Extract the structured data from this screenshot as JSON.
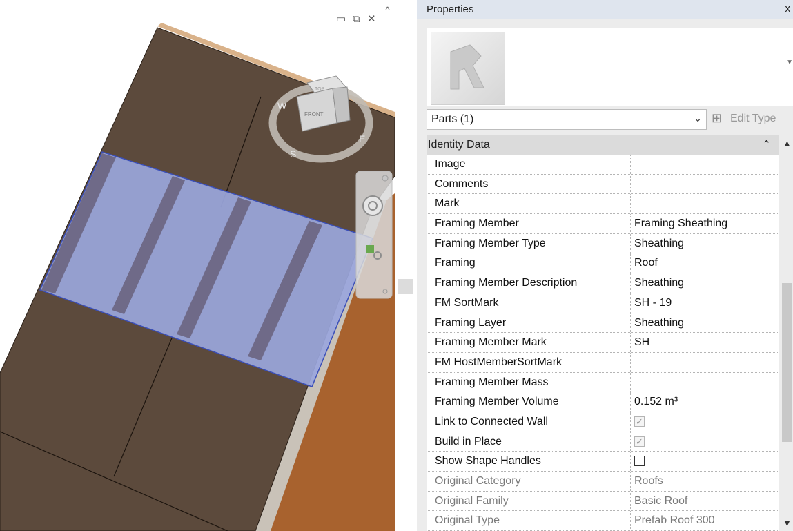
{
  "viewport": {
    "window_controls": [
      "▭",
      "⧉",
      "✕",
      "^"
    ],
    "viewcube": {
      "face": "FRONT",
      "top": "TOP",
      "compass": [
        "W",
        "S",
        "E"
      ]
    }
  },
  "properties": {
    "title": "Properties",
    "close": "x",
    "selector": {
      "label": "Parts (1)",
      "edit_type": "Edit Type"
    },
    "section": "Identity Data",
    "rows": [
      {
        "name": "Image",
        "value": ""
      },
      {
        "name": "Comments",
        "value": ""
      },
      {
        "name": "Mark",
        "value": ""
      },
      {
        "name": "Framing Member",
        "value": "Framing Sheathing"
      },
      {
        "name": "Framing Member Type",
        "value": "Sheathing"
      },
      {
        "name": "Framing",
        "value": "Roof"
      },
      {
        "name": "Framing Member Description",
        "value": "Sheathing"
      },
      {
        "name": "FM SortMark",
        "value": "SH - 19"
      },
      {
        "name": "Framing Layer",
        "value": "Sheathing"
      },
      {
        "name": "Framing Member Mark",
        "value": "SH"
      },
      {
        "name": "FM HostMemberSortMark",
        "value": ""
      },
      {
        "name": "Framing Member Mass",
        "value": ""
      },
      {
        "name": "Framing Member Volume",
        "value": "0.152 m³"
      },
      {
        "name": "Link to Connected Wall",
        "value": "",
        "checkbox": "checked-disabled"
      },
      {
        "name": "Build in Place",
        "value": "",
        "checkbox": "checked-disabled"
      },
      {
        "name": "Show Shape Handles",
        "value": "",
        "checkbox": "unchecked"
      },
      {
        "name": "Original Category",
        "value": "Roofs",
        "readonly": true
      },
      {
        "name": "Original Family",
        "value": "Basic Roof",
        "readonly": true
      },
      {
        "name": "Original Type",
        "value": "Prefab Roof 300",
        "readonly": true
      }
    ]
  },
  "colors": {
    "roof": "#5c4a3c",
    "selection": "#9aa6dc",
    "timber": "#a8622e"
  }
}
